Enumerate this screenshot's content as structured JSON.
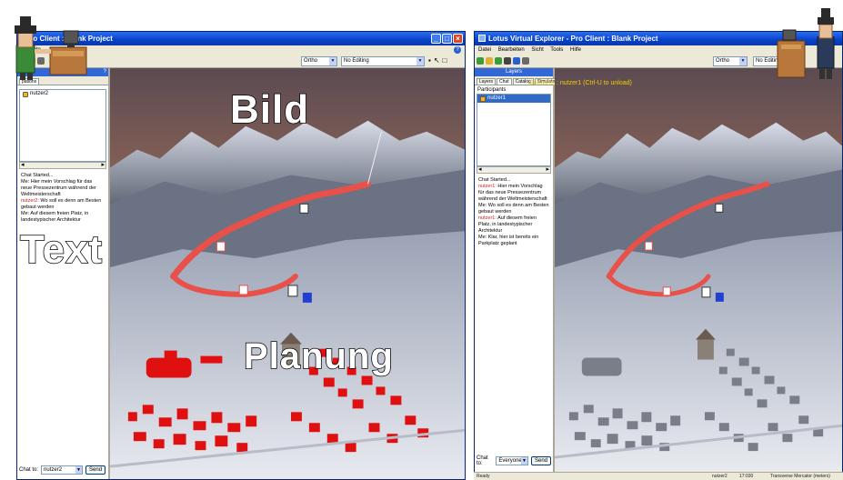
{
  "left_window": {
    "title": "- Pro Client : Blank Project",
    "menu": [
      "t",
      "Help"
    ],
    "mode_select": "Ortho",
    "editing_select": "No Editing",
    "panel": {
      "tab_partial": "pations",
      "user": "nutzer2",
      "chat_lines": [
        {
          "name": "",
          "text": "Chat Started..."
        },
        {
          "name": "Me:",
          "text": " Hier mein Vorschlag für das neue Pressezentrum während der Weltmeisterschaft"
        },
        {
          "name": "nutzer2:",
          "text": " Wo soll es denn am Besten gebaut werden"
        },
        {
          "name": "Me:",
          "text": " Auf diesem freien Platz, in landestypischer Architektur"
        }
      ],
      "chat_to_label": "Chat to:",
      "chat_to_value": "nutzer2",
      "send_label": "Send"
    }
  },
  "right_window": {
    "title": "Lotus Virtual Explorer - Pro Client : Blank Project",
    "menu": [
      "Datei",
      "Bearbeiten",
      "Sicht",
      "Tools",
      "Hilfe"
    ],
    "mode_select": "Ortho",
    "editing_select": "No Editing",
    "panel": {
      "header": "Layers",
      "tabs": [
        "Layers",
        "Chat",
        "Catalog",
        "Simulate"
      ],
      "participants_label": "Participants",
      "user": "nutzer1",
      "chat_lines": [
        {
          "name": "",
          "text": "Chat Started..."
        },
        {
          "name": "nutzer1:",
          "text": " Hier mein Vorschlag für das neue Pressezentrum während der Weltmeisterschaft"
        },
        {
          "name": "Me:",
          "text": " Wo soll es denn am Besten gebaut werden"
        },
        {
          "name": "nutzer1:",
          "text": " Auf diesem freien Platz, in landestypischer Architektur"
        },
        {
          "name": "Me:",
          "text": " Klar, hier ist bereits ein Parkplatz geplant"
        }
      ],
      "chat_to_label": "Chat to:",
      "chat_to_value": "Everyone",
      "send_label": "Send"
    },
    "sound_notice": "Sound to : nutzer1 (Ctrl-U to unload)",
    "status": {
      "left": "Ready",
      "user": "nutzer2",
      "time": "17:030",
      "info": "Transverse Mercator (meters)"
    }
  },
  "overlay": {
    "bild": "Bild",
    "text": "Text",
    "planung": "Planung"
  },
  "colors": {
    "title_blue": "#0a36a8",
    "sky_orange": "#c88050",
    "road_red": "#e8504a",
    "building_red": "#e01010",
    "sound_yellow": "#f2d000"
  }
}
